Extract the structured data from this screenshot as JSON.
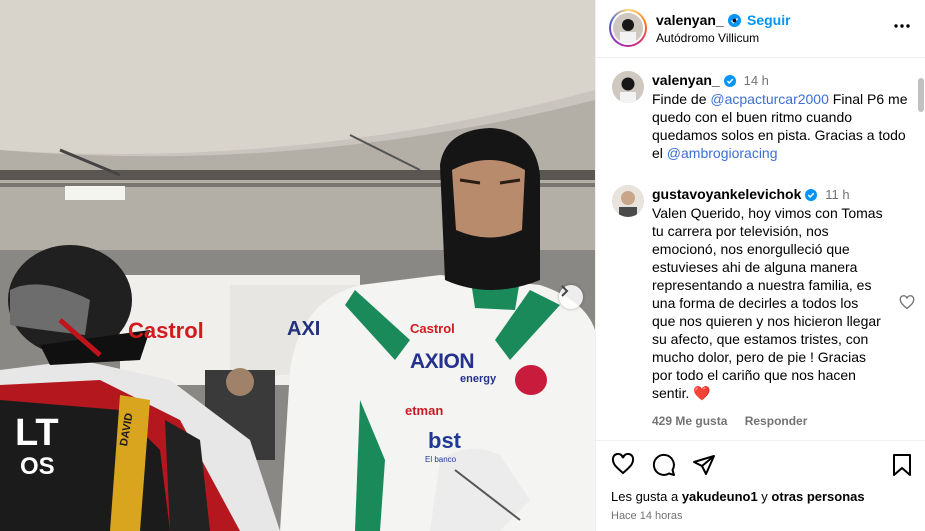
{
  "post": {
    "author": "valenyan_",
    "follow_label": "Seguir",
    "separator": "•",
    "location": "Autódromo Villicum",
    "posted_ago": "Hace 14 horas"
  },
  "caption": {
    "username": "valenyan_",
    "time": "14 h",
    "text_1": "Finde de ",
    "mention_1": "@acpacturcar2000",
    "text_2": " Final P6 me quedo con el buen ritmo cuando quedamos solos en pista. Gracias a todo el ",
    "mention_2": "@ambrogioracing"
  },
  "comment": {
    "username": "gustavoyankelevichok",
    "time": "11 h",
    "text": "Valen Querido, hoy vimos con Tomas tu carrera por televisión, nos emocionó, nos enorgulleció que estuvieses ahi de alguna manera representando a nuestra familia, es una forma de decirles a todos los que nos quieren y nos hicieron llegar su afecto, que estamos tristes, con mucho dolor, pero de pie ! Gracias por todo el cariño que nos hacen sentir. ",
    "emoji": "❤️",
    "likes": "429 Me gusta",
    "reply": "Responder"
  },
  "likes_summary": {
    "prefix": "Les gusta a ",
    "user": "yakudeuno1",
    "middle": " y ",
    "others": "otras personas"
  },
  "photo": {
    "signs": [
      "Castrol",
      "AXI"
    ],
    "suit_texts": [
      "Castrol",
      "AXION",
      "energy",
      "etman",
      "bst",
      "El banco"
    ],
    "car_texts": [
      "LT",
      "OS",
      "DAVID"
    ]
  },
  "icons": [
    "verified-icon",
    "more-options-icon",
    "heart-icon",
    "comment-icon",
    "share-icon",
    "bookmark-icon",
    "chevron-right-icon"
  ],
  "colors": {
    "accent": "#0095f6",
    "mention": "#00376b",
    "heart": "#ed4956",
    "suit_green": "#1a8a5a"
  }
}
